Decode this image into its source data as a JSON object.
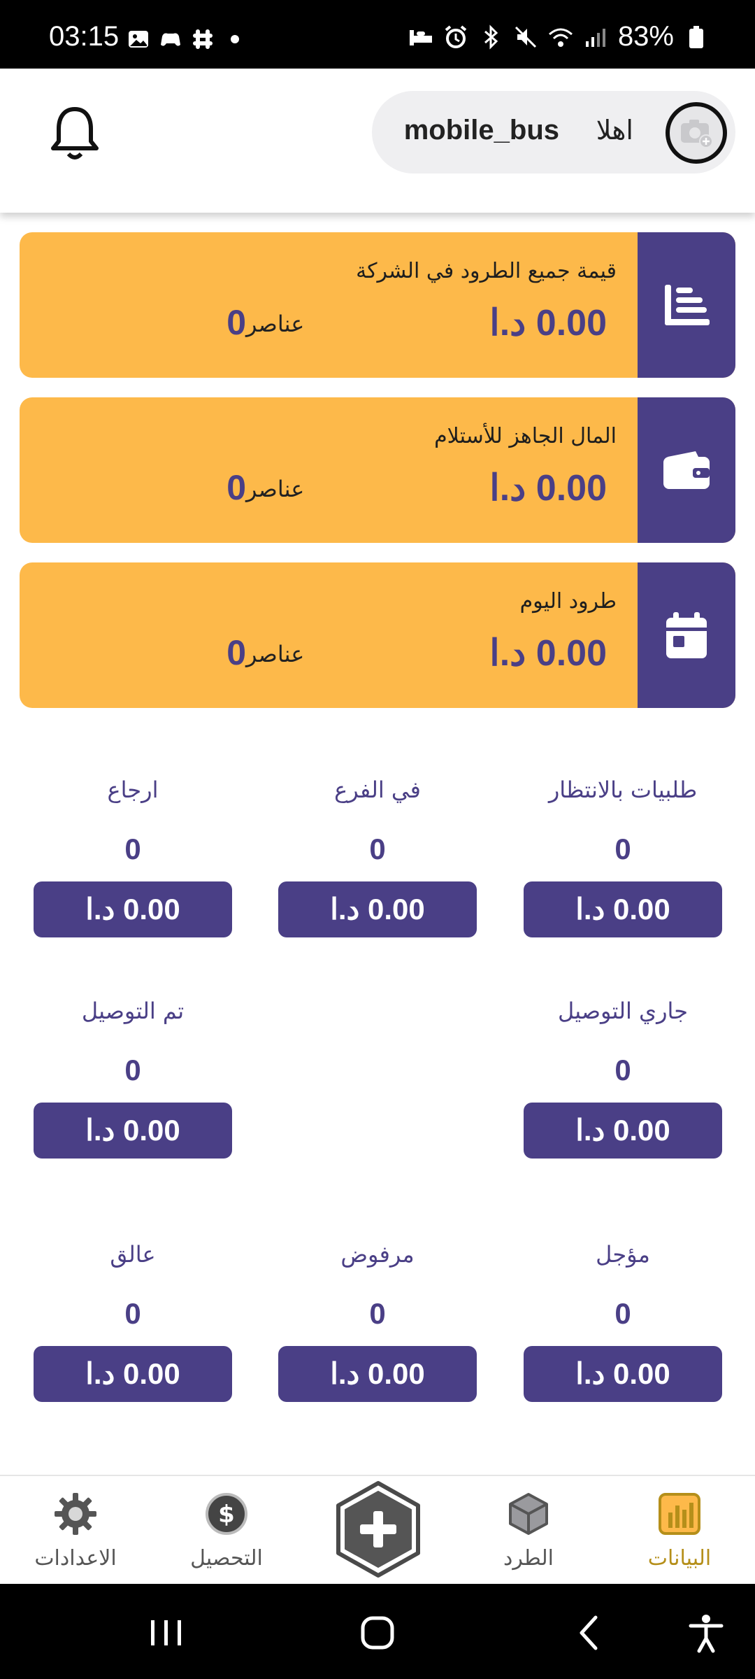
{
  "status_bar": {
    "time": "03:15",
    "battery": "83%"
  },
  "header": {
    "greeting": "اهلا",
    "username": "mobile_bus"
  },
  "summary_cards": [
    {
      "title": "قيمة جميع الطرود في الشركة",
      "amount": "0.00 د.ا",
      "count": "0",
      "items_label": "عناصر",
      "icon": "bar-chart-icon"
    },
    {
      "title": "المال الجاهز للأستلام",
      "amount": "0.00 د.ا",
      "count": "0",
      "items_label": "عناصر",
      "icon": "wallet-icon"
    },
    {
      "title": "طرود اليوم",
      "amount": "0.00 د.ا",
      "count": "0",
      "items_label": "عناصر",
      "icon": "calendar-icon"
    }
  ],
  "stats": {
    "pending": {
      "label": "طلبيات بالانتظار",
      "count": "0",
      "amount": "0.00 د.ا"
    },
    "in_branch": {
      "label": "في الفرع",
      "count": "0",
      "amount": "0.00 د.ا"
    },
    "returned": {
      "label": "ارجاع",
      "count": "0",
      "amount": "0.00 د.ا"
    },
    "delivering": {
      "label": "جاري التوصيل",
      "count": "0",
      "amount": "0.00 د.ا"
    },
    "delivered": {
      "label": "تم التوصيل",
      "count": "0",
      "amount": "0.00 د.ا"
    },
    "postponed": {
      "label": "مؤجل",
      "count": "0",
      "amount": "0.00 د.ا"
    },
    "rejected": {
      "label": "مرفوض",
      "count": "0",
      "amount": "0.00 د.ا"
    },
    "stuck": {
      "label": "عالق",
      "count": "0",
      "amount": "0.00 د.ا"
    }
  },
  "bottom_nav": {
    "data": "البيانات",
    "parcel": "الطرد",
    "collection": "التحصيل",
    "settings": "الاعدادات"
  },
  "colors": {
    "primary": "#4a3f86",
    "card": "#fdb94a",
    "active": "#b58f1a"
  }
}
